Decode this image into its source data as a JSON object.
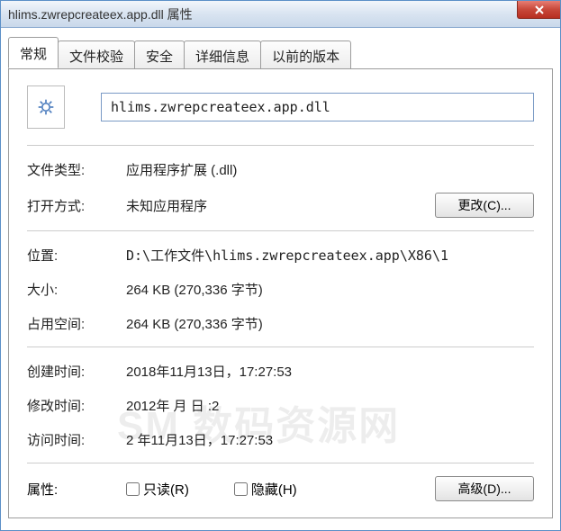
{
  "title": "hlims.zwrepcreateex.app.dll 属性",
  "tabs": [
    "常规",
    "文件校验",
    "安全",
    "详细信息",
    "以前的版本"
  ],
  "active_tab_index": 0,
  "filename": "hlims.zwrepcreateex.app.dll",
  "rows": {
    "filetype_label": "文件类型:",
    "filetype_value": "应用程序扩展 (.dll)",
    "openwith_label": "打开方式:",
    "openwith_value": "未知应用程序",
    "change_button": "更改(C)...",
    "location_label": "位置:",
    "location_value": "D:\\工作文件\\hlims.zwrepcreateex.app\\X86\\1",
    "size_label": "大小:",
    "size_value": "264 KB (270,336 字节)",
    "sizeondisk_label": "占用空间:",
    "sizeondisk_value": "264 KB (270,336 字节)",
    "created_label": "创建时间:",
    "created_value": "2018年11月13日，17:27:53",
    "modified_label": "修改时间:",
    "modified_value": "2012年    月    日        :2",
    "accessed_label": "访问时间:",
    "accessed_value": "2   年11月13日，17:27:53",
    "attributes_label": "属性:",
    "readonly_label": "只读(R)",
    "hidden_label": "隐藏(H)",
    "advanced_button": "高级(D)..."
  },
  "watermark": {
    "main": "SM 数码资源网",
    "sub": ""
  }
}
